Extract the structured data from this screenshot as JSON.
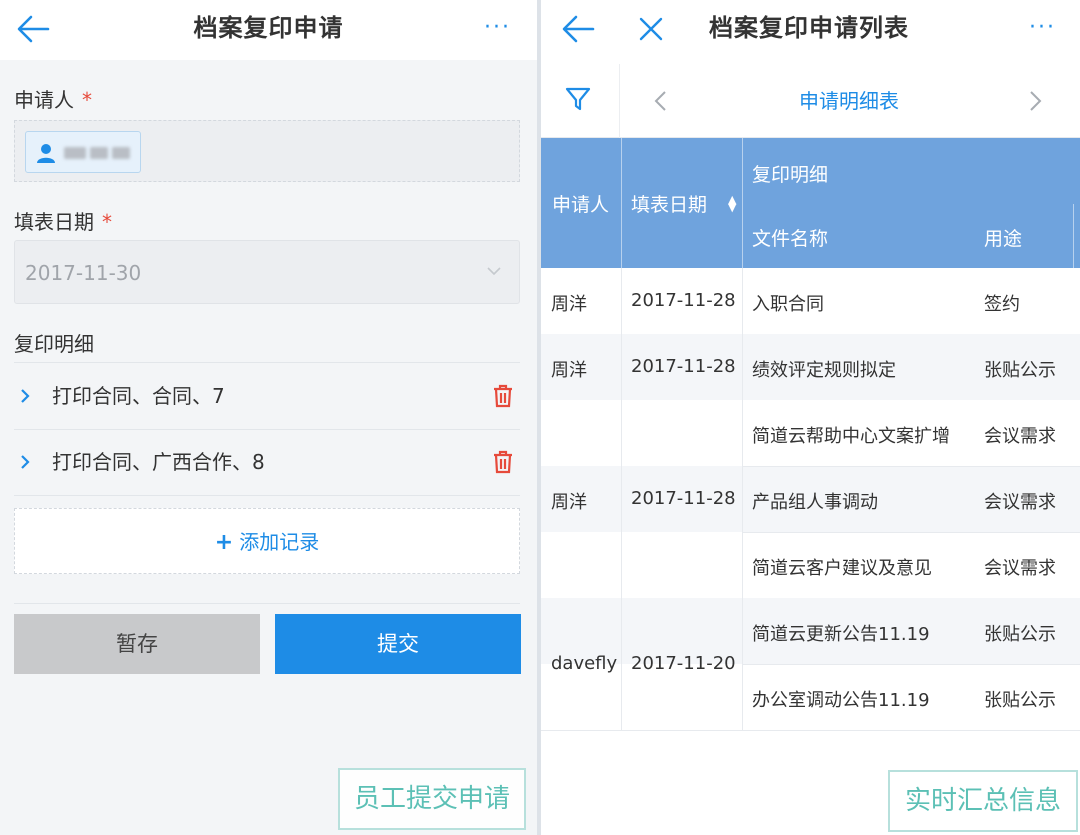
{
  "left": {
    "title": "档案复印申请",
    "more": "···",
    "applicant_label": "申请人",
    "required_mark": "*",
    "date_label": "填表日期",
    "date_value": "2017-11-30",
    "detail_label": "复印明细",
    "details": [
      {
        "text": "打印合同、合同、7"
      },
      {
        "text": "打印合同、广西合作、8"
      }
    ],
    "add_record": "添加记录",
    "save_label": "暂存",
    "submit_label": "提交",
    "caption": "员工提交申请"
  },
  "right": {
    "title": "档案复印申请列表",
    "more": "···",
    "subtitle": "申请明细表",
    "headers": {
      "applicant": "申请人",
      "date": "填表日期",
      "group": "复印明细",
      "file": "文件名称",
      "usage": "用途"
    },
    "groups": [
      {
        "applicant": "周洋",
        "date": "2017-11-28",
        "items": [
          {
            "file": "入职合同",
            "usage": "签约"
          }
        ]
      },
      {
        "applicant": "周洋",
        "date": "2017-11-28",
        "items": [
          {
            "file": "绩效评定规则拟定",
            "usage": "张贴公示"
          }
        ]
      },
      {
        "applicant": "周洋",
        "date": "2017-11-28",
        "items": [
          {
            "file": "简道云帮助中心文案扩增",
            "usage": "会议需求"
          },
          {
            "file": "产品组人事调动",
            "usage": "会议需求"
          },
          {
            "file": "简道云客户建议及意见",
            "usage": "会议需求"
          }
        ]
      },
      {
        "applicant": "davefly",
        "date": "2017-11-20",
        "items": [
          {
            "file": "简道云更新公告11.19",
            "usage": "张贴公示"
          },
          {
            "file": "办公室调动公告11.19",
            "usage": "张贴公示"
          }
        ]
      }
    ],
    "caption": "实时汇总信息"
  },
  "colors": {
    "accent": "#1e8ce6",
    "table_header": "#6fa3dd",
    "danger": "#e64a3b",
    "caption": "#5cc0b5"
  }
}
